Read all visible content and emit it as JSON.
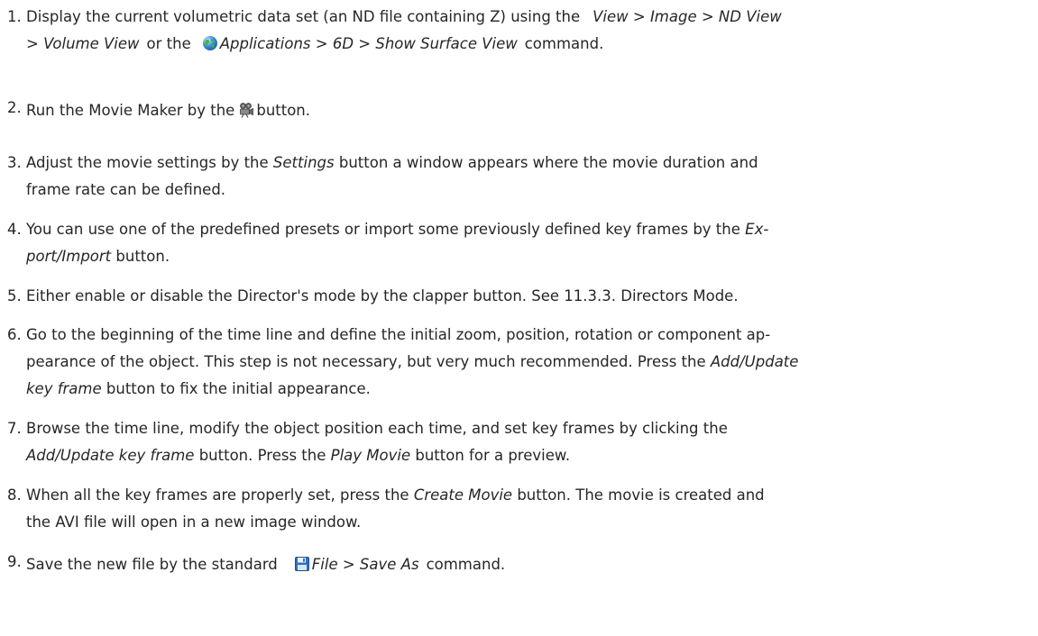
{
  "steps": [
    {
      "num": "1.",
      "t1": "Display the current volumetric data set (an ND file containing Z) using the",
      "t2": "View > Image > ND View",
      "t3": "> Volume View",
      "t4": "or the",
      "t5": "Applications > 6D > Show Surface View",
      "t6": "command."
    },
    {
      "num": "2.",
      "t1": "Run the Movie Maker by the",
      "t2": "button."
    },
    {
      "num": "3.",
      "t1": "Adjust the movie settings by the",
      "t2": "Settings",
      "t3": "button a window appears where the movie duration and",
      "t4": "frame rate can be defined."
    },
    {
      "num": "4.",
      "t1": "You can use one of the predefined presets or import some previously defined key frames by the",
      "t2": "Ex-",
      "t3": "port/Import",
      "t4": "button."
    },
    {
      "num": "5.",
      "t1": "Either enable or disable the Director's mode by the clapper button. See 11.3.3. Directors Mode."
    },
    {
      "num": "6.",
      "t1": "Go to the beginning of the time line and define the initial zoom, position, rotation or component ap-",
      "t2": "pearance of the object. This step is not necessary, but very much recommended. Press the",
      "t3": "Add/Update",
      "t4": "key frame",
      "t5": "button to fix the initial appearance."
    },
    {
      "num": "7.",
      "t1": "Browse the time line, modify the object position each time, and set key frames by clicking the",
      "t2": "Add/Update key frame",
      "t3": "button. Press the",
      "t4": "Play Movie",
      "t5": "button for a preview."
    },
    {
      "num": "8.",
      "t1": "When all the key frames are properly set, press the",
      "t2": "Create Movie",
      "t3": "button. The movie is created and",
      "t4": "the AVI file will open in a new image window."
    },
    {
      "num": "9.",
      "t1": "Save the new file by the standard",
      "t2": "File > Save As",
      "t3": "command."
    }
  ],
  "icons": {
    "globe": "globe-icon",
    "camera": "movie-camera-icon",
    "save": "floppy-disk-icon"
  }
}
